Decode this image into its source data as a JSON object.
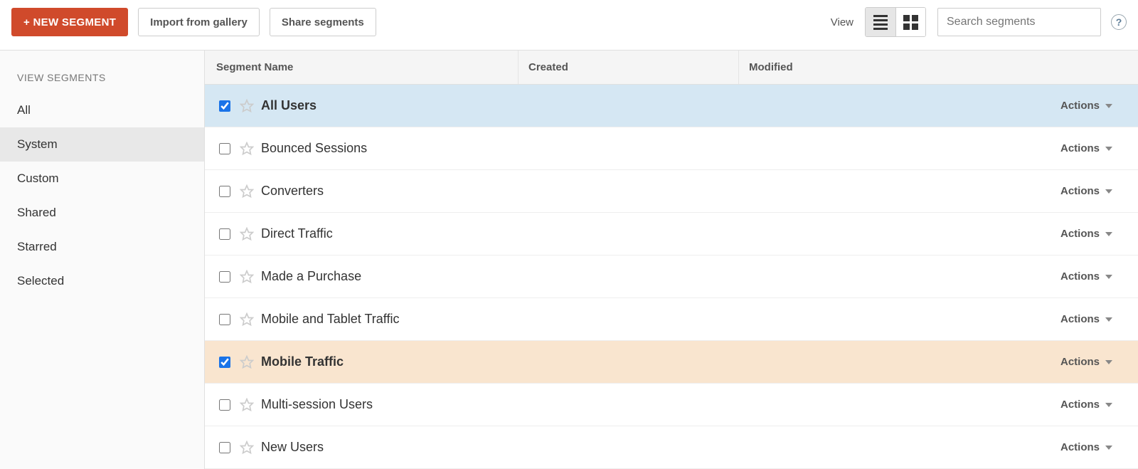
{
  "toolbar": {
    "new_segment": "+ NEW SEGMENT",
    "import": "Import from gallery",
    "share": "Share segments",
    "view_label": "View",
    "search_placeholder": "Search segments"
  },
  "sidebar": {
    "title": "VIEW SEGMENTS",
    "items": [
      "All",
      "System",
      "Custom",
      "Shared",
      "Starred",
      "Selected"
    ],
    "selected_index": 1
  },
  "table": {
    "head": {
      "name": "Segment Name",
      "created": "Created",
      "modified": "Modified"
    },
    "actions_label": "Actions",
    "rows": [
      {
        "name": "All Users",
        "checked": true,
        "starred": false,
        "highlight": "blue"
      },
      {
        "name": "Bounced Sessions",
        "checked": false,
        "starred": false,
        "highlight": ""
      },
      {
        "name": "Converters",
        "checked": false,
        "starred": false,
        "highlight": ""
      },
      {
        "name": "Direct Traffic",
        "checked": false,
        "starred": false,
        "highlight": ""
      },
      {
        "name": "Made a Purchase",
        "checked": false,
        "starred": false,
        "highlight": ""
      },
      {
        "name": "Mobile and Tablet Traffic",
        "checked": false,
        "starred": false,
        "highlight": ""
      },
      {
        "name": "Mobile Traffic",
        "checked": true,
        "starred": false,
        "highlight": "orange"
      },
      {
        "name": "Multi-session Users",
        "checked": false,
        "starred": false,
        "highlight": ""
      },
      {
        "name": "New Users",
        "checked": false,
        "starred": false,
        "highlight": ""
      }
    ]
  }
}
